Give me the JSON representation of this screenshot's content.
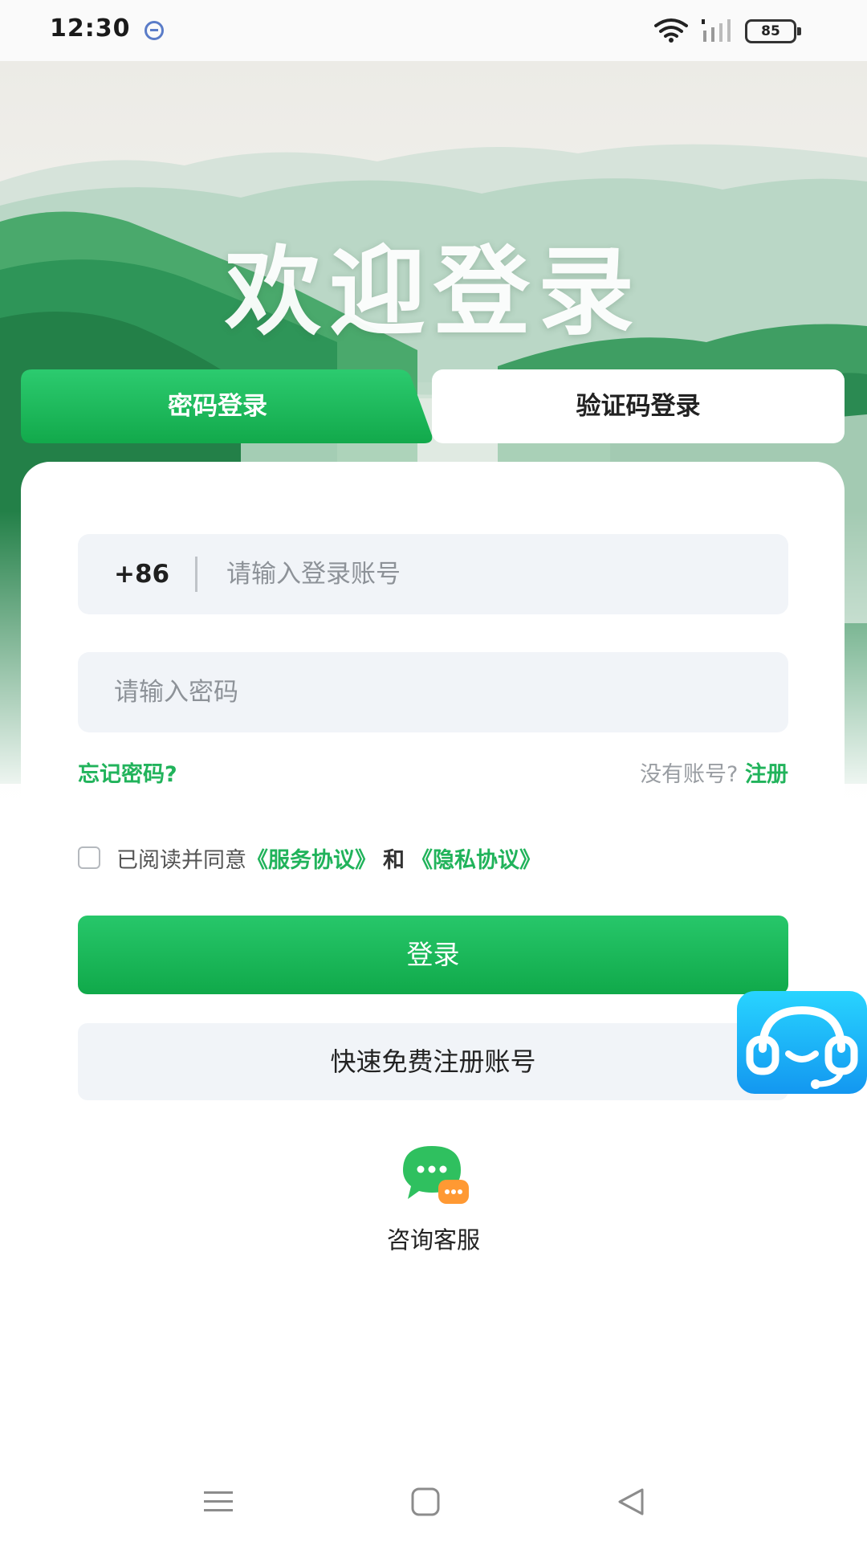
{
  "status_bar": {
    "time": "12:30",
    "battery": "85",
    "icons": [
      "do-not-disturb-icon",
      "wifi-icon",
      "signal-icon",
      "battery-icon"
    ]
  },
  "hero": {
    "title": "欢迎登录"
  },
  "tabs": [
    {
      "label": "密码登录",
      "active": true
    },
    {
      "label": "验证码登录",
      "active": false
    }
  ],
  "form": {
    "country_code": "+86",
    "account_placeholder": "请输入登录账号",
    "password_placeholder": "请输入密码",
    "forgot_password": "忘记密码?",
    "no_account": "没有账号?",
    "register": "注册"
  },
  "agreement": {
    "prefix": "已阅读并同意",
    "service": "《服务协议》",
    "and": "和",
    "privacy": "《隐私协议》"
  },
  "buttons": {
    "login": "登录",
    "quick_register": "快速免费注册账号"
  },
  "consult": {
    "label": "咨询客服"
  },
  "colors": {
    "brand_green": "#1db954",
    "link_green": "#21b35b",
    "input_bg": "#f1f4f8",
    "float_blue": "#1aa8f5"
  }
}
